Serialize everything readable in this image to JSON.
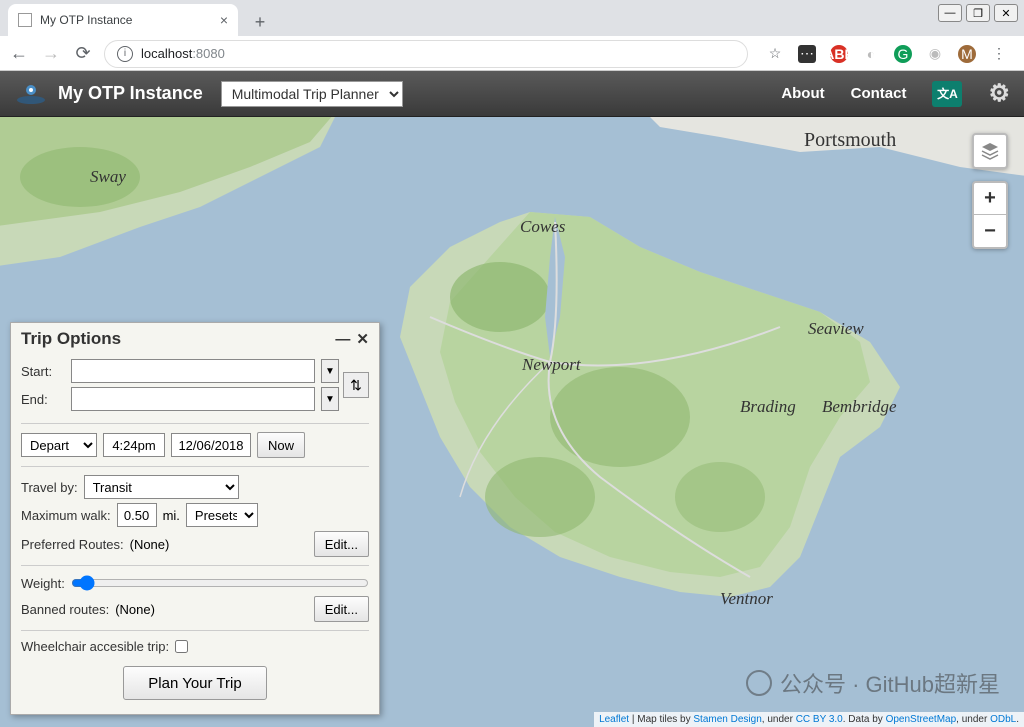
{
  "browser": {
    "tab_title": "My OTP Instance",
    "url_host": "localhost",
    "url_port": ":8080"
  },
  "header": {
    "app_title": "My OTP Instance",
    "mode": "Multimodal Trip Planner",
    "nav": {
      "about": "About",
      "contact": "Contact"
    }
  },
  "panel": {
    "title": "Trip Options",
    "start_label": "Start:",
    "end_label": "End:",
    "depart": "Depart",
    "time": "4:24pm",
    "date": "12/06/2018",
    "now": "Now",
    "travel_by_label": "Travel by:",
    "travel_by": "Transit",
    "max_walk_label": "Maximum walk:",
    "max_walk": "0.50",
    "max_walk_unit": "mi.",
    "presets": "Presets:",
    "pref_routes_label": "Preferred Routes:",
    "pref_routes_value": "(None)",
    "edit": "Edit...",
    "weight_label": "Weight:",
    "banned_label": "Banned routes:",
    "banned_value": "(None)",
    "wheelchair_label": "Wheelchair accesible trip:",
    "plan_btn": "Plan Your Trip"
  },
  "map": {
    "labels": {
      "sway": "Sway",
      "portsmouth": "Portsmouth",
      "cowes": "Cowes",
      "newport": "Newport",
      "seaview": "Seaview",
      "brading": "Brading",
      "bembridge": "Bembridge",
      "ventnor": "Ventnor"
    },
    "attribution": {
      "leaflet": "Leaflet",
      "sep1": " | Map tiles by ",
      "stamen": "Stamen Design",
      "sep2": ", under ",
      "cc": "CC BY 3.0",
      "sep3": ". Data by ",
      "osm": "OpenStreetMap",
      "sep4": ", under ",
      "odbl": "ODbL",
      "sep5": "."
    }
  },
  "watermark": "公众号 · GitHub超新星"
}
